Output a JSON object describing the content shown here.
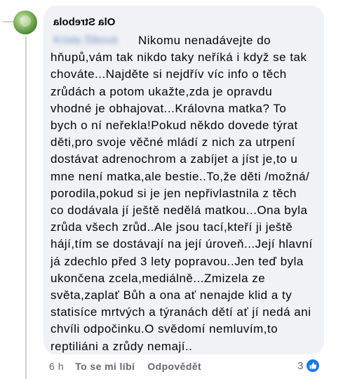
{
  "comment": {
    "author": "Ola Strebola",
    "tagged_name": "Krista Šibová",
    "lines": [
      "Nikomu nenadávejte do",
      "hňupů,vám tak nikdo taky neříká i když se tak",
      "chováte...Najděte si nejdřív víc info o těch",
      "zrůdách a potom ukažte,zda je opravdu",
      "vhodné je obhajovat...Královna matka? To",
      "bych o ní neřekla!Pokud někdo dovede týrat",
      "děti,pro svoje věčné mládí z nich za utrpení",
      "dostávat adrenochrom a zabíjet a jíst je,to u",
      "mne není matka,ale bestie..To,že děti /možná/",
      "porodila,pokud si je jen nepřivlastnila z těch",
      "co dodávala jí ještě nedělá matkou...Ona byla",
      "zrůda všech zrůd..Ale jsou tací,kteří ji ještě",
      "hájí,tím se dostávají na její úroveň...Její hlavní",
      "já zdechlo před 3 lety popravou..Jen teď byla",
      "ukončena zcela,mediálně...Zmizela ze",
      "světa,zaplať Bůh a ona ať nenajde klid a ty",
      "statisíce mrtvých a týranách dětí ať jí nedá ani",
      "chvíli odpočinku.O svědomí nemluvím,to",
      "reptiliáni  a zrůdy nemají.."
    ]
  },
  "actions": {
    "time": "6 h",
    "like_label": "To se mi líbí",
    "reply_label": "Odpovědět"
  },
  "reactions": {
    "count": "3",
    "icon": "thumbs-up-icon",
    "icon_color": "#1877f2"
  }
}
